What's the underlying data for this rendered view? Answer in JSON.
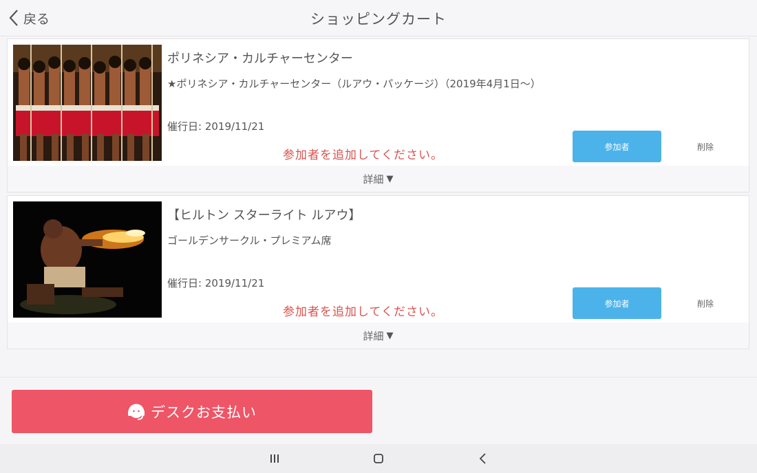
{
  "header": {
    "back_label": "戻る",
    "title": "ショッピングカート"
  },
  "cart": {
    "items": [
      {
        "title": "ポリネシア・カルチャーセンター",
        "subtitle": "★ポリネシア・カルチャーセンター（ルアウ・パッケージ）（2019年4月1日〜）",
        "date": "催行日: 2019/11/21",
        "warning": "参加者を追加してください。",
        "participant_label": "参加者",
        "delete_label": "削除",
        "details_label": "詳細"
      },
      {
        "title": "【ヒルトン スターライト ルアウ】",
        "subtitle": "ゴールデンサークル・プレミアム席",
        "date": "催行日: 2019/11/21",
        "warning": "参加者を追加してください。",
        "participant_label": "参加者",
        "delete_label": "削除",
        "details_label": "詳細"
      }
    ]
  },
  "footer": {
    "pay_label": "デスクお支払い"
  },
  "colors": {
    "accent_blue": "#4cb3ea",
    "pay_red": "#ee5566",
    "warning_red": "#d9534f"
  },
  "icons": {
    "back": "chevron-left-icon",
    "details": "triangle-down-icon",
    "pay": "headset-icon",
    "nav_recent": "recent-apps-icon",
    "nav_home": "home-icon",
    "nav_back": "nav-back-icon"
  }
}
